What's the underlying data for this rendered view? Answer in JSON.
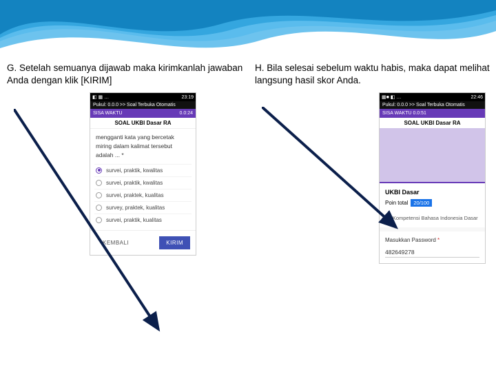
{
  "instructions": {
    "g": {
      "letter": "G.",
      "text": "Setelah semuanya dijawab maka kirimkanlah jawaban Anda dengan klik [KIRIM]"
    },
    "h": {
      "letter": "H.",
      "text": "Bila selesai sebelum waktu habis, maka dapat melihat langsung hasil skor Anda."
    }
  },
  "left_phone": {
    "status_time": "23:19",
    "crumb": "Pukul: 0.0.0 >> Soal Terbuka Otomatis",
    "timer_label": "SISA WAKTU",
    "timer_value": "0.0:24",
    "title": "SOAL UKBI Dasar RA",
    "question": "mengganti kata yang bercetak miring dalam kalimat tersebut adalah ... *",
    "options": [
      "survei, praktik, kwalitas",
      "survei, praktik, kwalitas",
      "survei, praktek, kualitas",
      "survey, praktek, kualitas",
      "survei, praktik, kualitas"
    ],
    "selected_index": 0,
    "btn_back": "KEMBALI",
    "btn_send": "KIRIM"
  },
  "right_phone": {
    "status_time": "22:46",
    "crumb": "Pukul: 0.0.0 >> Soal Terbuka Otomatis",
    "timer": "SISA WAKTU 0.0:51",
    "title": "SOAL UKBI Dasar RA",
    "card_title": "UKBI Dasar",
    "score_label": "Poin total",
    "score_value": "20/100",
    "subtitle": "Uji Kompetensi Bahasa Indonesia Dasar",
    "pw_label": "Masukkan Password",
    "pw_asterisk": "*",
    "pw_value": "482649278"
  }
}
